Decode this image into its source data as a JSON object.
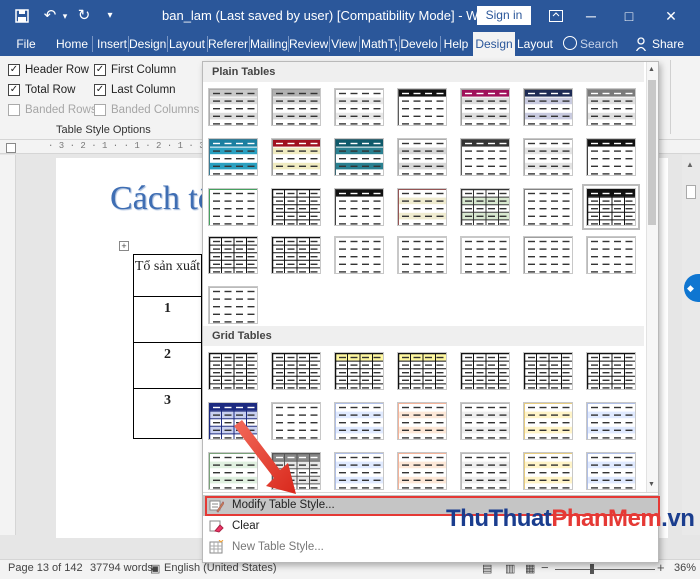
{
  "window": {
    "title": "ban_lam (Last saved by user) [Compatibility Mode]  -  Word",
    "sign_in": "Sign in",
    "qat": [
      "save-icon",
      "undo-icon",
      "redo-icon"
    ]
  },
  "ribbon": {
    "tabs": [
      "File",
      "Home",
      "Insert",
      "Design",
      "Layout",
      "Referer",
      "Mailing",
      "Review",
      "View",
      "MathTy",
      "Develo",
      "Help",
      "Design",
      "Layout"
    ],
    "active_tab": "Design (Table Tools)",
    "tell_me": "Search",
    "share": "Share"
  },
  "table_style_options": {
    "group_label": "Table Style Options",
    "header_row": "Header Row",
    "total_row": "Total Row",
    "banded_rows": "Banded Rows",
    "first_column": "First Column",
    "last_column": "Last Column",
    "banded_columns": "Banded Columns"
  },
  "ruler": {
    "text": "· 3 · 2 · 1 ·  · 1 · 2 · 1 · 3 ·"
  },
  "document": {
    "heading": "Cách tô m",
    "table": {
      "header": [
        "Tổ sản xuất"
      ],
      "rows": [
        "1",
        "2",
        "3"
      ]
    }
  },
  "gallery": {
    "plain_tables": "Plain Tables",
    "grid_tables": "Grid Tables"
  },
  "menu": {
    "modify": "Modify Table Style...",
    "clear": "Clear",
    "new": "New Table Style..."
  },
  "status": {
    "page": "Page 13 of 142",
    "words": "37794 words",
    "language": "English (United States)",
    "zoom": "36%"
  },
  "watermark": {
    "part1": "ThuThuat",
    "part2": "PhanMem",
    "part3": ".vn"
  },
  "colors": {
    "accent": "#2b579a",
    "highlight": "#e53935"
  }
}
